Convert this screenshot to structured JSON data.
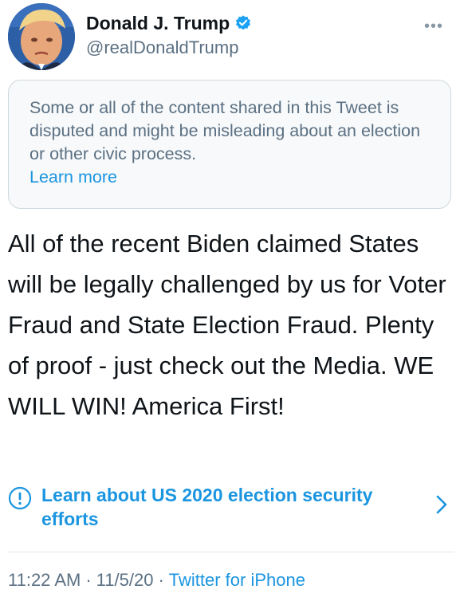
{
  "author": {
    "display_name": "Donald J. Trump",
    "handle": "@realDonaldTrump",
    "verified": true,
    "avatar_icon": "profile-photo"
  },
  "menu": {
    "more_label": "•••"
  },
  "notice": {
    "text": "Some or all of the content shared in this Tweet is disputed and might be misleading about an election or other civic process.",
    "link_label": "Learn more"
  },
  "tweet": {
    "text": "All of the recent Biden claimed States will be legally challenged by us for Voter Fraud and State Election Fraud. Plenty of proof - just check out the Media. WE WILL WIN! America First!"
  },
  "election_info": {
    "icon": "exclamation-circle-icon",
    "label": "Learn about US 2020 election security efforts"
  },
  "meta": {
    "time": "11:22 AM",
    "separator": "·",
    "date": "11/5/20",
    "source": "Twitter for iPhone"
  },
  "colors": {
    "link": "#1b95e0",
    "secondary_text": "#5b7083",
    "notice_bg": "#f7f9fa",
    "verified": "#1da1f2"
  }
}
